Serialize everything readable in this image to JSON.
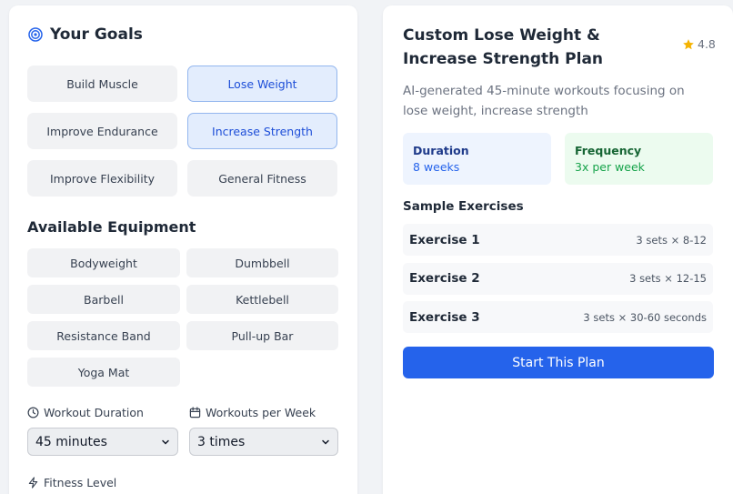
{
  "goals": {
    "title": "Your Goals",
    "items": [
      {
        "label": "Build Muscle",
        "selected": false
      },
      {
        "label": "Lose Weight",
        "selected": true
      },
      {
        "label": "Improve Endurance",
        "selected": false
      },
      {
        "label": "Increase Strength",
        "selected": true
      },
      {
        "label": "Improve Flexibility",
        "selected": false
      },
      {
        "label": "General Fitness",
        "selected": false
      }
    ]
  },
  "equipment": {
    "title": "Available Equipment",
    "items": [
      "Bodyweight",
      "Dumbbell",
      "Barbell",
      "Kettlebell",
      "Resistance Band",
      "Pull-up Bar",
      "Yoga Mat"
    ]
  },
  "duration": {
    "label": "Workout Duration",
    "value": "45 minutes"
  },
  "per_week": {
    "label": "Workouts per Week",
    "value": "3 times"
  },
  "fitness_level": {
    "label": "Fitness Level"
  },
  "plan": {
    "title": "Custom Lose Weight & Increase Strength Plan",
    "rating": "4.8",
    "description": "AI-generated 45-minute workouts focusing on lose weight, increase strength",
    "duration_label": "Duration",
    "duration_value": "8 weeks",
    "frequency_label": "Frequency",
    "frequency_value": "3x per week",
    "samples_title": "Sample Exercises",
    "exercises": [
      {
        "name": "Exercise 1",
        "detail": "3 sets × 8-12"
      },
      {
        "name": "Exercise 2",
        "detail": "3 sets × 12-15"
      },
      {
        "name": "Exercise 3",
        "detail": "3 sets × 30-60 seconds"
      }
    ],
    "start_label": "Start This Plan"
  },
  "colors": {
    "accent": "#2563eb",
    "selected_bg": "#e3edfd",
    "frequency_bg": "#ecfbef",
    "star": "#f5b301"
  },
  "icons": {
    "goals": "target-icon",
    "rating": "star-icon",
    "duration": "clock-icon",
    "per_week": "calendar-icon",
    "fitness_level": "lightning-icon",
    "select": "chevron-down-icon"
  }
}
